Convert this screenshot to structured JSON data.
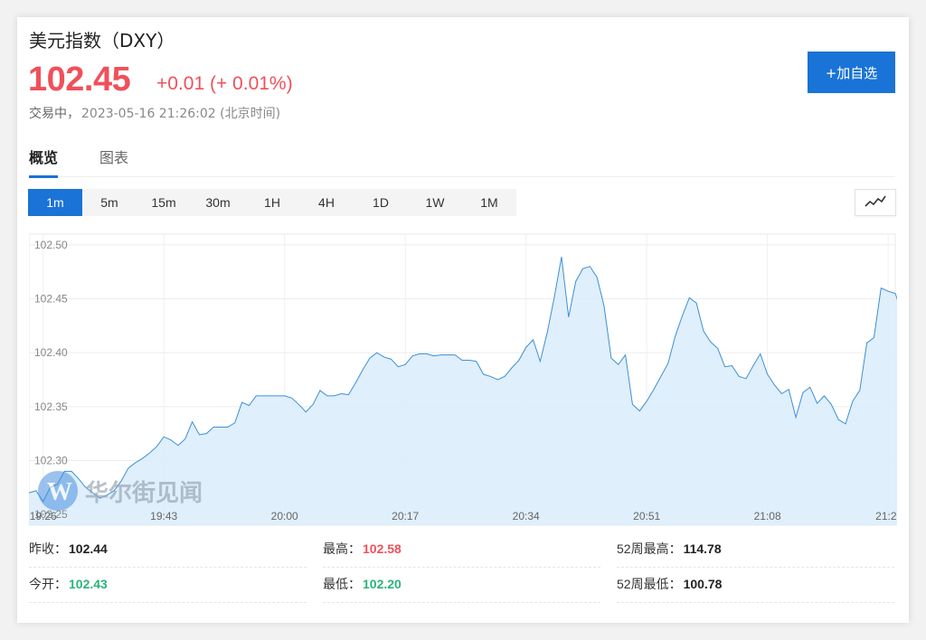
{
  "header": {
    "title": "美元指数（DXY）",
    "price": "102.45",
    "change": "+0.01 (+ 0.01%)",
    "status": "交易中，",
    "timestamp": "2023-05-16 21:26:02 (北京时间)",
    "add_watchlist": "+加自选"
  },
  "tabs": [
    {
      "label": "概览",
      "active": true
    },
    {
      "label": "图表",
      "active": false
    }
  ],
  "periods": [
    {
      "label": "1m",
      "active": true
    },
    {
      "label": "5m"
    },
    {
      "label": "15m"
    },
    {
      "label": "30m"
    },
    {
      "label": "1H"
    },
    {
      "label": "4H"
    },
    {
      "label": "1D"
    },
    {
      "label": "1W"
    },
    {
      "label": "1M"
    }
  ],
  "watermark": "华尔街见闻",
  "colors": {
    "accent": "#1a73d6",
    "up": "#f0505a",
    "down": "#2bb37a",
    "line": "#3d8fd6",
    "fill": "#dcedfb"
  },
  "chart_data": {
    "type": "area",
    "y_ticks": [
      "102.50",
      "102.45",
      "102.40",
      "102.35",
      "102.30",
      "102.25"
    ],
    "x_ticks": [
      "19:26",
      "19:43",
      "20:00",
      "20:17",
      "20:34",
      "20:51",
      "21:08",
      "21:2"
    ],
    "ylim": [
      102.24,
      102.51
    ],
    "xlim": [
      0,
      122
    ],
    "grid": true,
    "values": [
      102.27,
      102.272,
      102.262,
      102.275,
      102.278,
      102.29,
      102.29,
      102.283,
      102.275,
      102.27,
      102.265,
      102.268,
      102.272,
      102.281,
      102.293,
      102.298,
      102.302,
      102.307,
      102.313,
      102.322,
      102.319,
      102.314,
      102.32,
      102.336,
      102.324,
      102.325,
      102.331,
      102.331,
      102.331,
      102.335,
      102.354,
      102.351,
      102.36,
      102.36,
      102.36,
      102.36,
      102.36,
      102.358,
      102.352,
      102.345,
      102.352,
      102.365,
      102.36,
      102.36,
      102.362,
      102.361,
      102.372,
      102.384,
      102.395,
      102.4,
      102.396,
      102.394,
      102.387,
      102.389,
      102.397,
      102.399,
      102.399,
      102.397,
      102.398,
      102.398,
      102.398,
      102.393,
      102.393,
      102.392,
      102.38,
      102.378,
      102.375,
      102.378,
      102.386,
      102.393,
      102.405,
      102.412,
      102.392,
      102.419,
      102.452,
      102.489,
      102.433,
      102.466,
      102.478,
      102.48,
      102.47,
      102.443,
      102.395,
      102.389,
      102.398,
      102.352,
      102.346,
      102.355,
      102.366,
      102.378,
      102.39,
      102.415,
      102.434,
      102.451,
      102.446,
      102.42,
      102.41,
      102.404,
      102.387,
      102.388,
      102.378,
      102.376,
      102.388,
      102.399,
      102.38,
      102.37,
      102.362,
      102.366,
      102.34,
      102.363,
      102.368,
      102.353,
      102.36,
      102.352,
      102.338,
      102.334,
      102.355,
      102.365,
      102.409,
      102.414,
      102.46,
      102.457,
      102.455,
      102.436,
      102.44,
      102.443,
      102.443,
      102.447,
      102.458
    ]
  },
  "stats": [
    {
      "label": "昨收：",
      "value": "102.44",
      "tone": "dark"
    },
    {
      "label": "最高：",
      "value": "102.58",
      "tone": "red"
    },
    {
      "label": "52周最高：",
      "value": "114.78",
      "tone": "dark"
    },
    {
      "label": "今开：",
      "value": "102.43",
      "tone": "green"
    },
    {
      "label": "最低：",
      "value": "102.20",
      "tone": "green"
    },
    {
      "label": "52周最低：",
      "value": "100.78",
      "tone": "dark"
    }
  ]
}
